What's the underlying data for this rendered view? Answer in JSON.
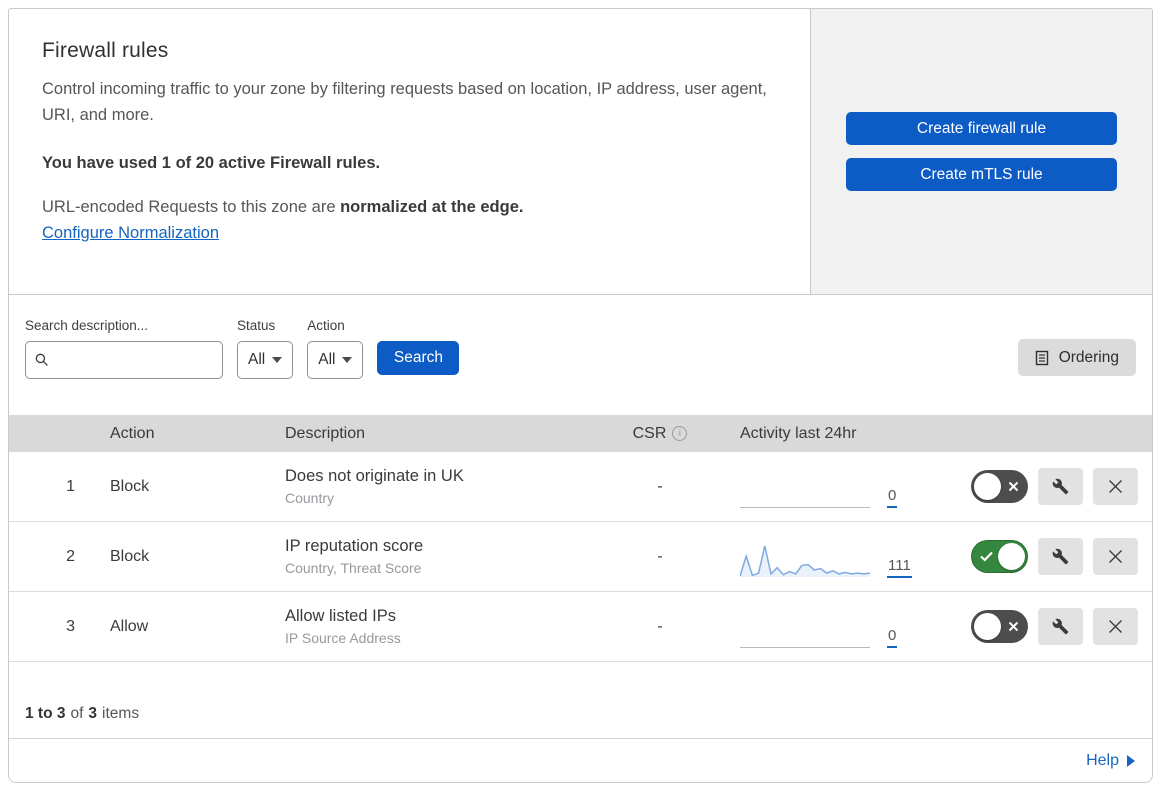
{
  "header": {
    "title": "Firewall rules",
    "description": "Control incoming traffic to your zone by filtering requests based on location, IP address, user agent, URI, and more.",
    "usage": "You have used 1 of 20 active Firewall rules.",
    "normalization_text": "URL-encoded Requests to this zone are ",
    "normalization_bold": "normalized at the edge.",
    "normalization_link": "Configure Normalization"
  },
  "actions_panel": {
    "create_firewall_rule": "Create firewall rule",
    "create_mtls_rule": "Create mTLS rule"
  },
  "filters": {
    "search_label": "Search description...",
    "search_placeholder": "",
    "status_label": "Status",
    "status_value": "All",
    "action_label": "Action",
    "action_value": "All",
    "search_button": "Search",
    "ordering_button": "Ordering"
  },
  "table": {
    "columns": {
      "action": "Action",
      "description": "Description",
      "csr": "CSR",
      "activity": "Activity last 24hr"
    },
    "rows": [
      {
        "index": "1",
        "action": "Block",
        "description": "Does not originate in UK",
        "fields": "Country",
        "csr": "-",
        "activity_count": "0",
        "enabled": false,
        "sparkline": []
      },
      {
        "index": "2",
        "action": "Block",
        "description": "IP reputation score",
        "fields": "Country, Threat Score",
        "csr": "-",
        "activity_count": "111",
        "enabled": true,
        "sparkline": [
          1,
          27,
          2,
          5,
          40,
          4,
          12,
          3,
          7,
          4,
          15,
          16,
          9,
          11,
          5,
          8,
          4,
          6,
          4,
          5,
          4,
          5
        ]
      },
      {
        "index": "3",
        "action": "Allow",
        "description": "Allow listed IPs",
        "fields": "IP Source Address",
        "csr": "-",
        "activity_count": "0",
        "enabled": false,
        "sparkline": []
      }
    ]
  },
  "footer": {
    "range_bold": "1 to 3",
    "of_text": "of",
    "total_bold": "3",
    "items_text": "items",
    "help_label": "Help"
  },
  "colors": {
    "button_blue": "#0d5bc5",
    "link_blue": "#1565c0",
    "toggle_on": "#35873f",
    "toggle_off": "#4d4d4d",
    "sparkline": "#7fa9e0",
    "sparkline_fill": "#e3eefa",
    "header_bg": "#d9d9d9"
  }
}
